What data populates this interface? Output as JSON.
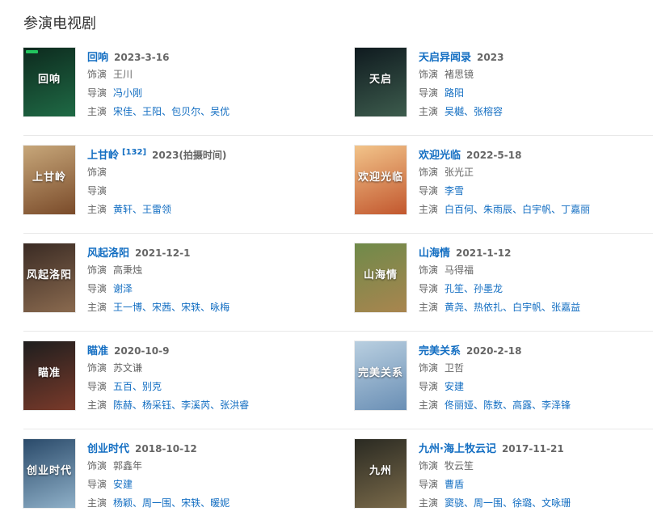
{
  "section": {
    "title": "参演电视剧"
  },
  "items": [
    {
      "title": "回响",
      "sup": "",
      "date": "2023-3-16",
      "role_label": "饰演",
      "role": "王川",
      "director_label": "导演",
      "director": "冯小刚",
      "cast_label": "主演",
      "cast": [
        "宋佳",
        "王阳",
        "包贝尔",
        "吴优"
      ],
      "poster_text": "回响",
      "poster_colors": [
        "#0d2a1e",
        "#1f6a45"
      ]
    },
    {
      "title": "天启异闻录",
      "sup": "",
      "date": "2023",
      "role_label": "饰演",
      "role": "褚思镜",
      "director_label": "导演",
      "director": "路阳",
      "cast_label": "主演",
      "cast": [
        "吴樾",
        "张榕容"
      ],
      "poster_text": "天启",
      "poster_colors": [
        "#0f1a1f",
        "#3d5c4d"
      ]
    },
    {
      "title": "上甘岭",
      "sup": "[132]",
      "date": "2023(拍摄时间)",
      "role_label": "饰演",
      "role": "",
      "director_label": "导演",
      "director": "",
      "cast_label": "主演",
      "cast": [
        "黄轩",
        "王雷领"
      ],
      "poster_text": "上甘岭",
      "poster_colors": [
        "#c7a77a",
        "#7a4b2a"
      ]
    },
    {
      "title": "欢迎光临",
      "sup": "",
      "date": "2022-5-18",
      "role_label": "饰演",
      "role": "张光正",
      "director_label": "导演",
      "director": "李雪",
      "cast_label": "主演",
      "cast": [
        "白百何",
        "朱雨辰",
        "白宇帆",
        "丁嘉丽"
      ],
      "poster_text": "欢迎光临",
      "poster_colors": [
        "#f2c48a",
        "#c2572e"
      ]
    },
    {
      "title": "风起洛阳",
      "sup": "",
      "date": "2021-12-1",
      "role_label": "饰演",
      "role": "高秉烛",
      "director_label": "导演",
      "director": "谢泽",
      "cast_label": "主演",
      "cast": [
        "王一博",
        "宋茜",
        "宋轶",
        "咏梅"
      ],
      "poster_text": "风起洛阳",
      "poster_colors": [
        "#3a2b24",
        "#8a6a4f"
      ]
    },
    {
      "title": "山海情",
      "sup": "",
      "date": "2021-1-12",
      "role_label": "饰演",
      "role": "马得福",
      "director_label": "导演",
      "director": "孔笙、孙墨龙",
      "cast_label": "主演",
      "cast": [
        "黄尧",
        "热依扎",
        "白宇帆",
        "张嘉益"
      ],
      "poster_text": "山海情",
      "poster_colors": [
        "#6f8a4a",
        "#a9854f"
      ]
    },
    {
      "title": "瞄准",
      "sup": "",
      "date": "2020-10-9",
      "role_label": "饰演",
      "role": "苏文谦",
      "director_label": "导演",
      "director": "五百、别克",
      "cast_label": "主演",
      "cast": [
        "陈赫",
        "杨采钰",
        "李溪芮",
        "张洪睿"
      ],
      "poster_text": "瞄准",
      "poster_colors": [
        "#1e1e1e",
        "#7a3a2a"
      ]
    },
    {
      "title": "完美关系",
      "sup": "",
      "date": "2020-2-18",
      "role_label": "饰演",
      "role": "卫哲",
      "director_label": "导演",
      "director": "安建",
      "cast_label": "主演",
      "cast": [
        "佟丽娅",
        "陈数",
        "高露",
        "李泽锋"
      ],
      "poster_text": "完美关系",
      "poster_colors": [
        "#b9cfe0",
        "#6a8fb5"
      ]
    },
    {
      "title": "创业时代",
      "sup": "",
      "date": "2018-10-12",
      "role_label": "饰演",
      "role": "郭鑫年",
      "director_label": "导演",
      "director": "安建",
      "cast_label": "主演",
      "cast": [
        "杨颖",
        "周一围",
        "宋轶",
        "暖妮"
      ],
      "poster_text": "创业时代",
      "poster_colors": [
        "#2a4a6a",
        "#8fb0c8"
      ]
    },
    {
      "title": "九州·海上牧云记",
      "sup": "",
      "date": "2017-11-21",
      "role_label": "饰演",
      "role": "牧云笙",
      "director_label": "导演",
      "director": "曹盾",
      "cast_label": "主演",
      "cast": [
        "窦骁",
        "周一围",
        "徐璐",
        "文咏珊"
      ],
      "poster_text": "九州",
      "poster_colors": [
        "#2a2a22",
        "#7a6a4a"
      ]
    }
  ]
}
